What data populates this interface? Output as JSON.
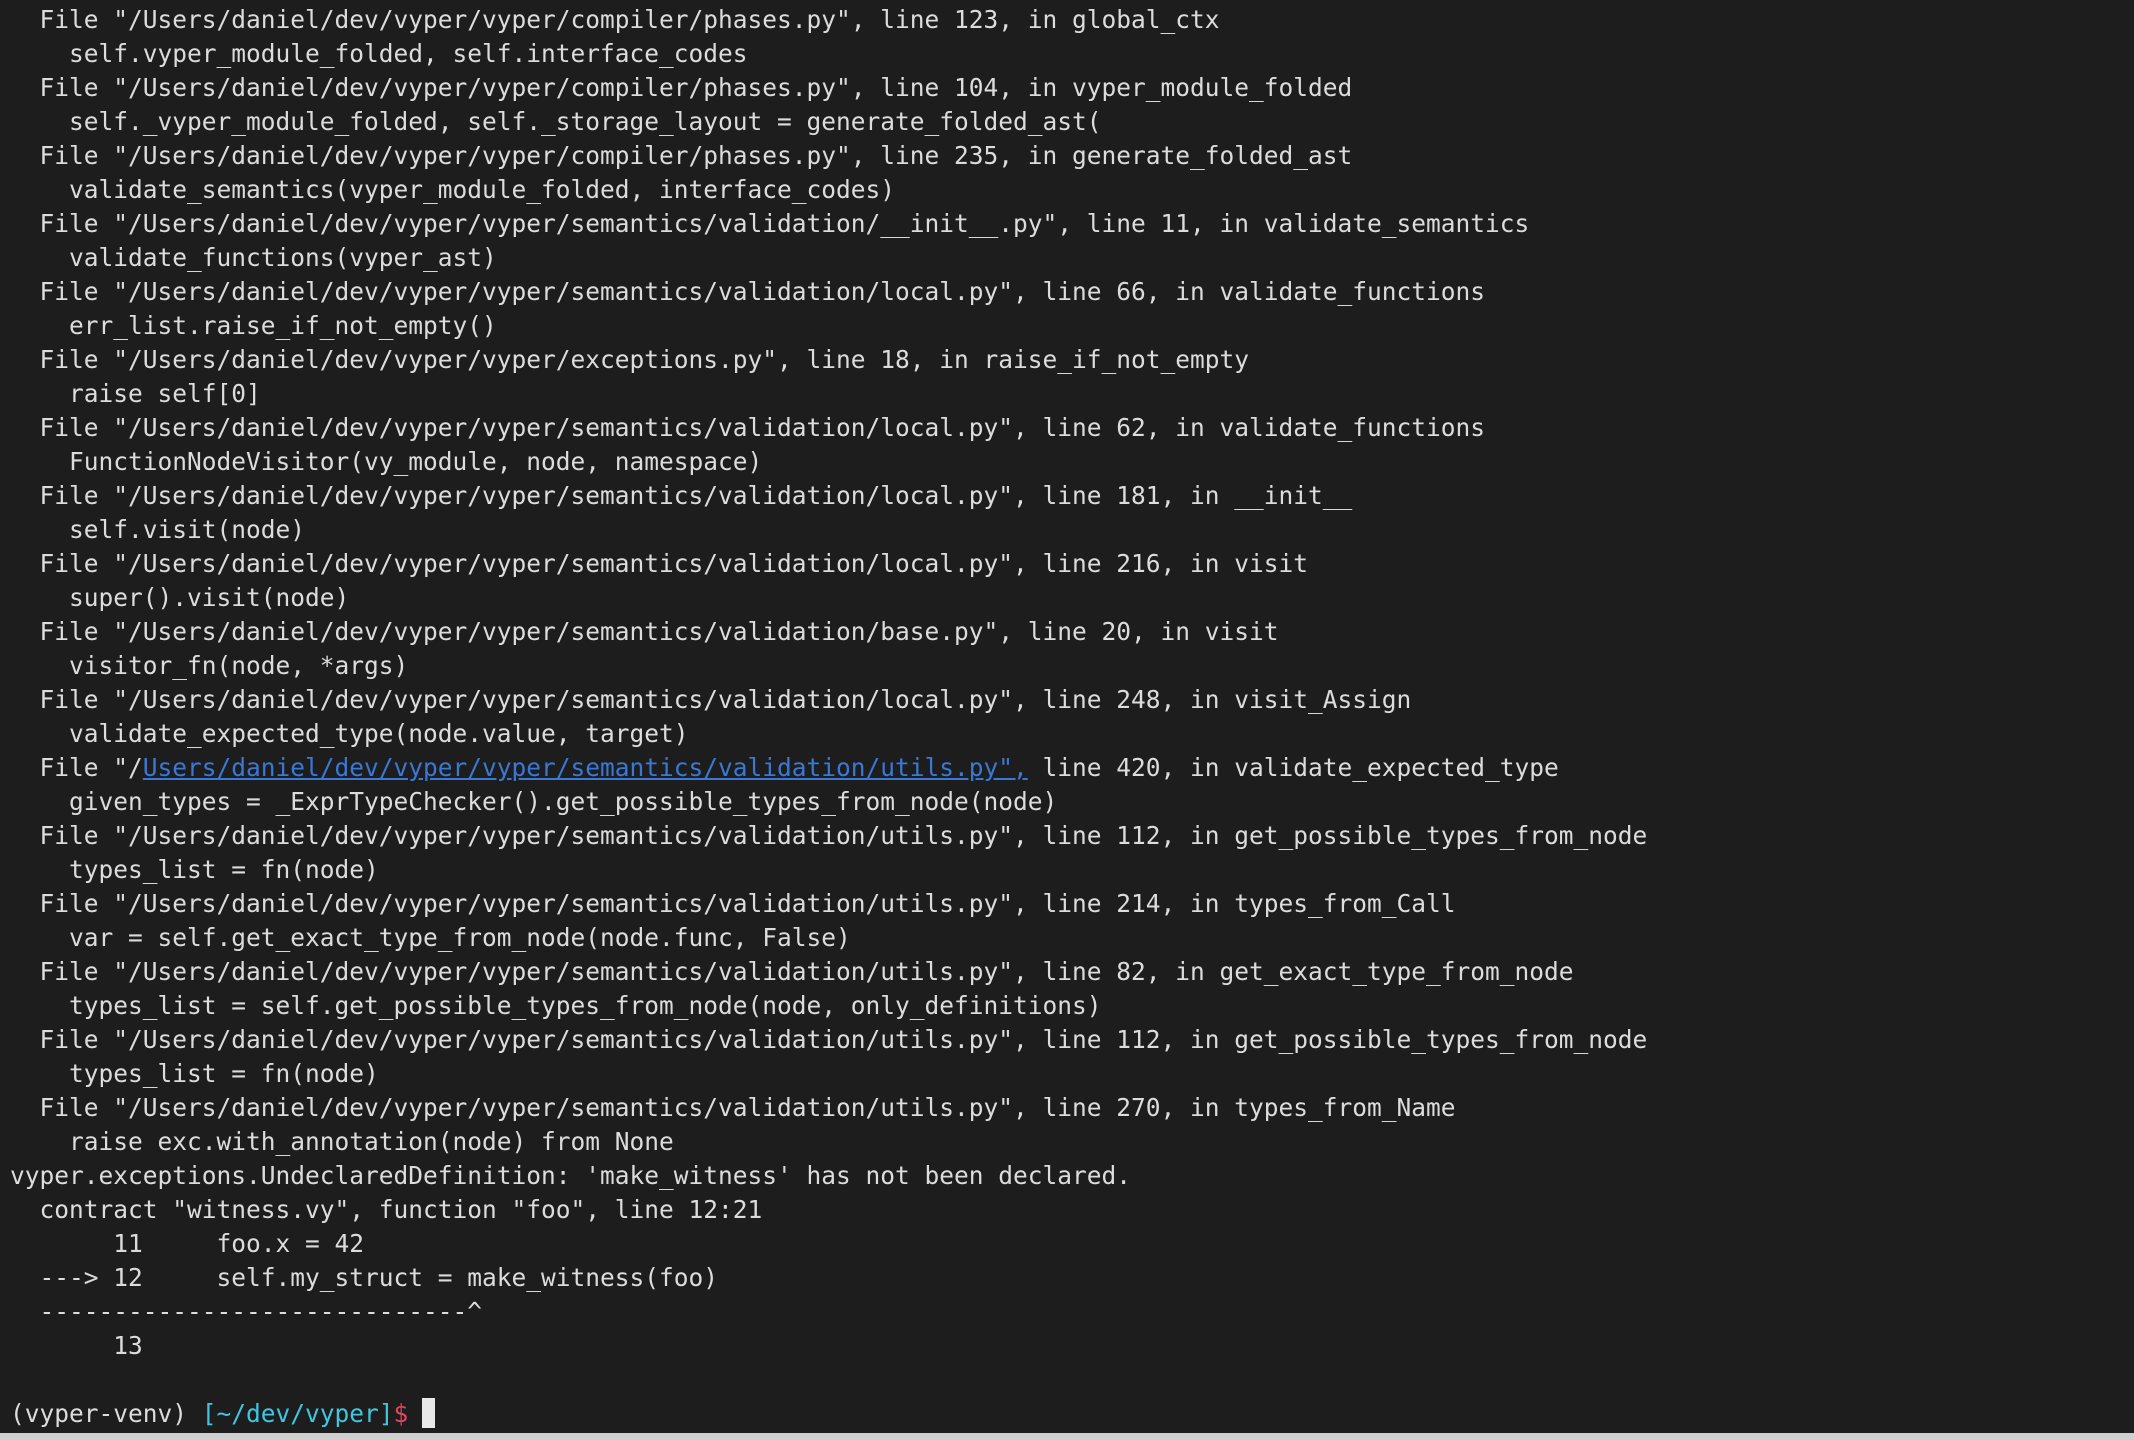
{
  "terminal": {
    "lines": [
      "  File \"/Users/daniel/dev/vyper/vyper/compiler/phases.py\", line 123, in global_ctx",
      "    self.vyper_module_folded, self.interface_codes",
      "  File \"/Users/daniel/dev/vyper/vyper/compiler/phases.py\", line 104, in vyper_module_folded",
      "    self._vyper_module_folded, self._storage_layout = generate_folded_ast(",
      "  File \"/Users/daniel/dev/vyper/vyper/compiler/phases.py\", line 235, in generate_folded_ast",
      "    validate_semantics(vyper_module_folded, interface_codes)",
      "  File \"/Users/daniel/dev/vyper/vyper/semantics/validation/__init__.py\", line 11, in validate_semantics",
      "    validate_functions(vyper_ast)",
      "  File \"/Users/daniel/dev/vyper/vyper/semantics/validation/local.py\", line 66, in validate_functions",
      "    err_list.raise_if_not_empty()",
      "  File \"/Users/daniel/dev/vyper/vyper/exceptions.py\", line 18, in raise_if_not_empty",
      "    raise self[0]",
      "  File \"/Users/daniel/dev/vyper/vyper/semantics/validation/local.py\", line 62, in validate_functions",
      "    FunctionNodeVisitor(vy_module, node, namespace)",
      "  File \"/Users/daniel/dev/vyper/vyper/semantics/validation/local.py\", line 181, in __init__",
      "    self.visit(node)",
      "  File \"/Users/daniel/dev/vyper/vyper/semantics/validation/local.py\", line 216, in visit",
      "    super().visit(node)",
      "  File \"/Users/daniel/dev/vyper/vyper/semantics/validation/base.py\", line 20, in visit",
      "    visitor_fn(node, *args)",
      "  File \"/Users/daniel/dev/vyper/vyper/semantics/validation/local.py\", line 248, in visit_Assign",
      "    validate_expected_type(node.value, target)"
    ],
    "link_line": {
      "prefix": "  File \"/",
      "link": "Users/daniel/dev/vyper/vyper/semantics/validation/utils.py\",",
      "suffix": " line 420, in validate_expected_type"
    },
    "lines_after": [
      "    given_types = _ExprTypeChecker().get_possible_types_from_node(node)",
      "  File \"/Users/daniel/dev/vyper/vyper/semantics/validation/utils.py\", line 112, in get_possible_types_from_node",
      "    types_list = fn(node)",
      "  File \"/Users/daniel/dev/vyper/vyper/semantics/validation/utils.py\", line 214, in types_from_Call",
      "    var = self.get_exact_type_from_node(node.func, False)",
      "  File \"/Users/daniel/dev/vyper/vyper/semantics/validation/utils.py\", line 82, in get_exact_type_from_node",
      "    types_list = self.get_possible_types_from_node(node, only_definitions)",
      "  File \"/Users/daniel/dev/vyper/vyper/semantics/validation/utils.py\", line 112, in get_possible_types_from_node",
      "    types_list = fn(node)",
      "  File \"/Users/daniel/dev/vyper/vyper/semantics/validation/utils.py\", line 270, in types_from_Name",
      "    raise exc.with_annotation(node) from None",
      "vyper.exceptions.UndeclaredDefinition: 'make_witness' has not been declared.",
      "  contract \"witness.vy\", function \"foo\", line 12:21",
      "       11     foo.x = 42",
      "  ---> 12     self.my_struct = make_witness(foo)",
      "  -----------------------------^",
      "       13"
    ],
    "prompt": {
      "env": "(vyper-venv) ",
      "dir": "[~/dev/vyper]",
      "symbol": "$"
    }
  },
  "colors": {
    "background": "#1d1d1d",
    "text": "#dcdcdc",
    "link": "#3a78d6",
    "prompt_dir": "#3fc6e0",
    "prompt_symbol": "#e6455d"
  }
}
